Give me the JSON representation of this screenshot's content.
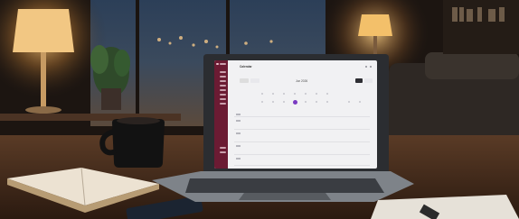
{
  "screen": {
    "app_title": "Calendar",
    "month_label": "Jun 2026"
  },
  "colors": {
    "sidebar": "#6b1b33",
    "accent_day": "#7a3ac2",
    "lamp_glow": "#f3c06a",
    "room": "#1a1512"
  }
}
